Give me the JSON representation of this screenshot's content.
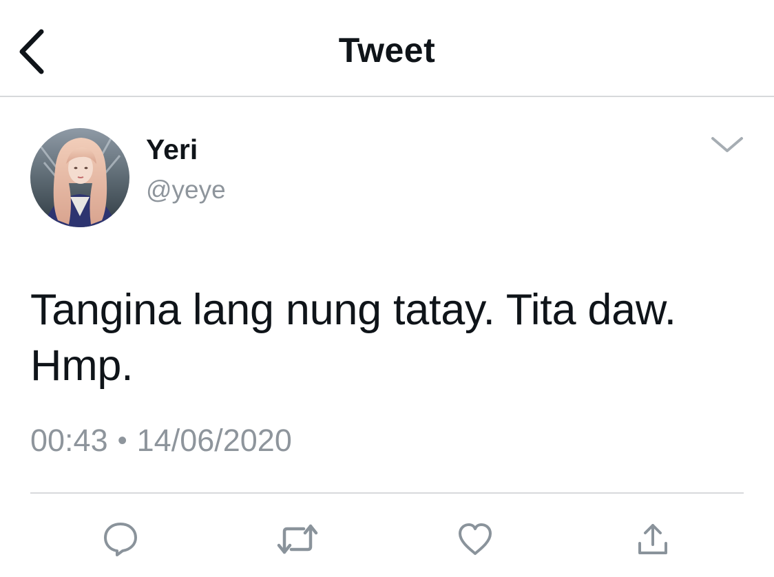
{
  "header": {
    "title": "Tweet",
    "back_icon": "chevron-left-icon"
  },
  "author": {
    "name": "Yeri",
    "handle": "@yeye",
    "avatar_icon": "avatar"
  },
  "tweet": {
    "text_line1": "Tangina lang nung tatay. Tita daw.",
    "text_line2": "Hmp.",
    "time": "00:43",
    "separator": "•",
    "date": "14/06/2020"
  },
  "actions": {
    "reply_icon": "reply-icon",
    "retweet_icon": "retweet-icon",
    "like_icon": "heart-icon",
    "share_icon": "share-icon"
  },
  "colors": {
    "text_primary": "#0f1419",
    "text_secondary": "#8e959c",
    "icon_gray": "#8a939b",
    "divider": "#d7d9db"
  }
}
